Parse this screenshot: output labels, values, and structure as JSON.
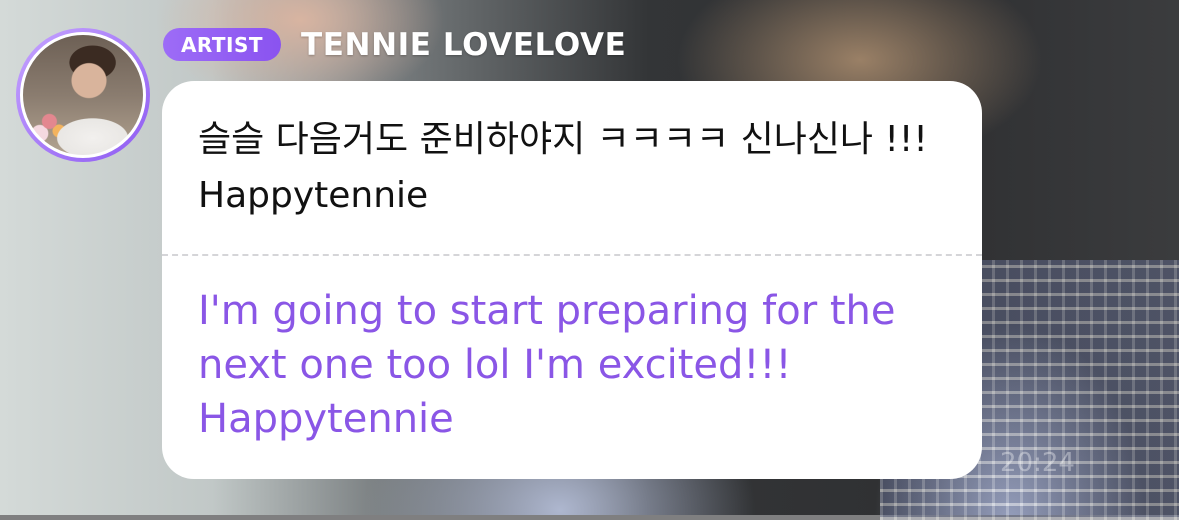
{
  "post": {
    "badge": "ARTIST",
    "author": "TENNIE LOVELOVE",
    "original_text": "슬슬 다음거도 준비하야지 ㅋㅋㅋㅋ 신나신나 !!! Happytennie",
    "translation": "I'm going to start preparing for the next one too lol I'm excited!!! Happytennie",
    "timestamp": "20:24"
  },
  "colors": {
    "badge": "#8f5bf2",
    "translation_text": "#8a56e6",
    "card": "#ffffff"
  }
}
